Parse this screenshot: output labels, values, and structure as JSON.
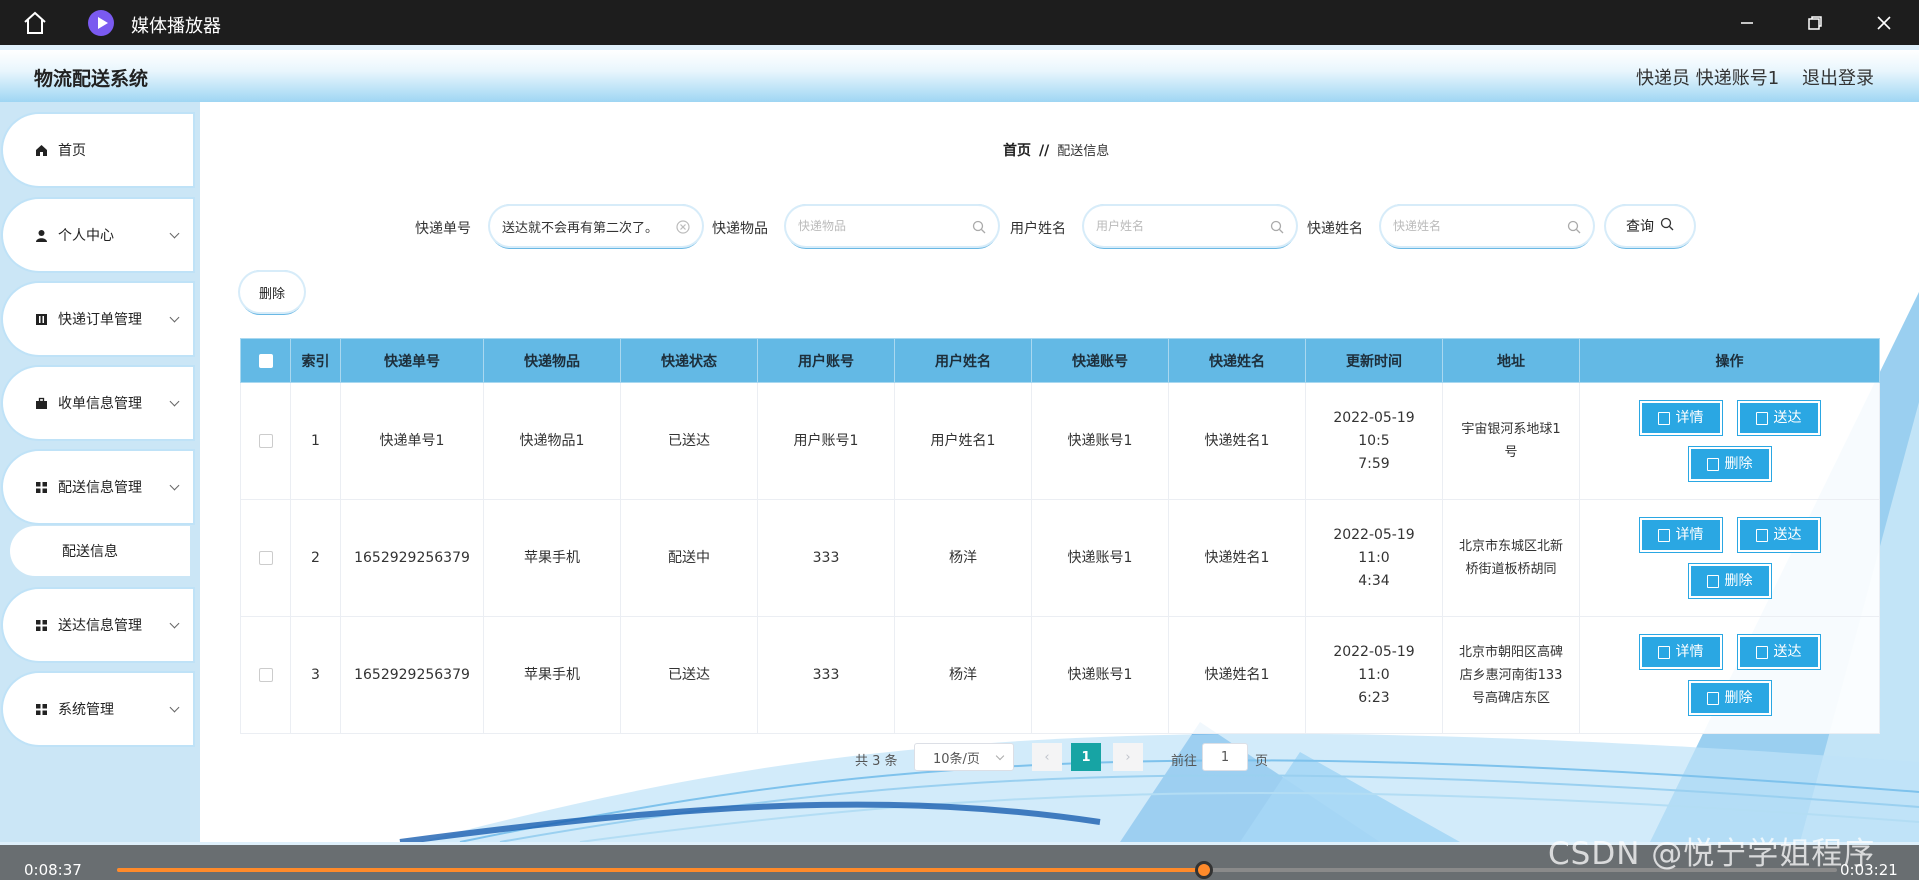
{
  "player": {
    "title": "媒体播放器",
    "time_current": "0:08:37",
    "time_total": "0:03:21",
    "progress": 0.632
  },
  "header": {
    "system_title": "物流配送系统",
    "courier_label": "快递员 快递账号1",
    "logout": "退出登录"
  },
  "sidebar": {
    "items": [
      {
        "label": "首页",
        "icon": "home-icon"
      },
      {
        "label": "个人中心",
        "icon": "user-icon"
      },
      {
        "label": "快递订单管理",
        "icon": "book-icon"
      },
      {
        "label": "收单信息管理",
        "icon": "briefcase-icon"
      },
      {
        "label": "配送信息管理",
        "icon": "grid-icon"
      },
      {
        "label": "送达信息管理",
        "icon": "grid-icon"
      },
      {
        "label": "系统管理",
        "icon": "grid-icon"
      }
    ],
    "sub_item": "配送信息"
  },
  "breadcrumb": {
    "home": "首页",
    "separator": "//",
    "current": "配送信息"
  },
  "search": {
    "tracking_label": "快递单号",
    "tracking_value": "送达就不会再有第二次了。",
    "item_label": "快递物品",
    "item_placeholder": "快递物品",
    "user_name_label": "用户姓名",
    "user_name_placeholder": "用户姓名",
    "courier_name_label": "快递姓名",
    "courier_name_placeholder": "快递姓名",
    "query_button": "查询"
  },
  "toolbar": {
    "delete": "删除"
  },
  "table": {
    "headers": [
      "索引",
      "快递单号",
      "快递物品",
      "快递状态",
      "用户账号",
      "用户姓名",
      "快递账号",
      "快递姓名",
      "更新时间",
      "地址",
      "操作"
    ],
    "rows": [
      {
        "index": "1",
        "tracking_no": "快递单号1",
        "item": "快递物品1",
        "status": "已送达",
        "user_account": "用户账号1",
        "user_name": "用户姓名1",
        "courier_account": "快递账号1",
        "courier_name": "快递姓名1",
        "updated_1": "2022-05-19 10:5",
        "updated_2": "7:59",
        "addr_1": "宇宙银河系地球1",
        "addr_2": "号",
        "addr_3": ""
      },
      {
        "index": "2",
        "tracking_no": "1652929256379",
        "item": "苹果手机",
        "status": "配送中",
        "user_account": "333",
        "user_name": "杨洋",
        "courier_account": "快递账号1",
        "courier_name": "快递姓名1",
        "updated_1": "2022-05-19 11:0",
        "updated_2": "4:34",
        "addr_1": "北京市东城区北新",
        "addr_2": "桥街道板桥胡同",
        "addr_3": ""
      },
      {
        "index": "3",
        "tracking_no": "1652929256379",
        "item": "苹果手机",
        "status": "已送达",
        "user_account": "333",
        "user_name": "杨洋",
        "courier_account": "快递账号1",
        "courier_name": "快递姓名1",
        "updated_1": "2022-05-19 11:0",
        "updated_2": "6:23",
        "addr_1": "北京市朝阳区高碑",
        "addr_2": "店乡惠河南街133",
        "addr_3": "号高碑店东区"
      }
    ],
    "actions": {
      "detail": "详情",
      "deliver": "送达",
      "delete": "删除"
    }
  },
  "pagination": {
    "total": "共 3 条",
    "page_size": "10条/页",
    "current_page": "1",
    "goto_label": "前往",
    "goto_value": "1",
    "page_suffix": "页"
  },
  "watermark": "CSDN @悦宁学姐程序"
}
